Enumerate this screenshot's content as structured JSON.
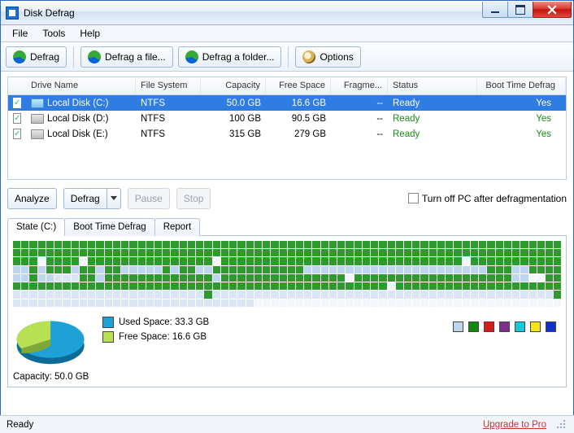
{
  "window": {
    "title": "Disk Defrag"
  },
  "menu": {
    "file": "File",
    "tools": "Tools",
    "help": "Help"
  },
  "toolbar": {
    "defrag": "Defrag",
    "defrag_file": "Defrag a file...",
    "defrag_folder": "Defrag a folder...",
    "options": "Options"
  },
  "columns": {
    "drive": "Drive Name",
    "fs": "File System",
    "capacity": "Capacity",
    "free": "Free Space",
    "frag": "Fragme...",
    "status": "Status",
    "boot": "Boot Time Defrag"
  },
  "drives": [
    {
      "name": "Local Disk (C:)",
      "fs": "NTFS",
      "capacity": "50.0 GB",
      "free": "16.6 GB",
      "frag": "--",
      "status": "Ready",
      "boot": "Yes",
      "selected": true
    },
    {
      "name": "Local Disk (D:)",
      "fs": "NTFS",
      "capacity": "100 GB",
      "free": "90.5 GB",
      "frag": "--",
      "status": "Ready",
      "boot": "Yes",
      "selected": false
    },
    {
      "name": "Local Disk (E:)",
      "fs": "NTFS",
      "capacity": "315 GB",
      "free": "279 GB",
      "frag": "--",
      "status": "Ready",
      "boot": "Yes",
      "selected": false
    }
  ],
  "actions": {
    "analyze": "Analyze",
    "defrag": "Defrag",
    "pause": "Pause",
    "stop": "Stop",
    "turnoff": "Turn off PC after defragmentation"
  },
  "tabs": {
    "state": "State (C:)",
    "boot": "Boot Time Defrag",
    "report": "Report"
  },
  "legend": {
    "used": "Used Space: 33.3 GB",
    "free": "Free Space: 16.6 GB",
    "capacity": "Capacity: 50.0 GB"
  },
  "legend_colors": [
    "#bdd5ef",
    "#108a10",
    "#d31c1c",
    "#7e2f8e",
    "#18c8d8",
    "#f4e515",
    "#1030c8"
  ],
  "pie": {
    "used_color": "#1ea1d6",
    "free_color": "#b7e052",
    "used_frac": 0.666
  },
  "status": {
    "ready": "Ready",
    "upgrade": "Upgrade to Pro"
  },
  "cluster_rows": [
    "gggggggggggggggggggggggggggggggggggggggggggggggggggggggggggggggggg",
    "gggggggggggggggggggggggggggggggggggggggggggggggggggggggggggggggggg",
    "gggwggggwgggggggggggggggwgggggggggggggggggggggggggggggwggggggggggg",
    "llglggglgglgglllllglggllgggggggggggllllllllllllllllllllllgggllgggg",
    "llgllvvvgglggggggggggggglgggggggggggggggwgggggggggggggggggggllwwgg",
    "gggggggggggggggggggggggggggggggggggggggggggggwgggggggggggggggggggg",
    "vvvvvvvvvvvvvvvvvvvvvvvgvvvvvvvvvvvvvvvvvvvvvvvvvvvvvvvvvvvvvvvvvg",
    "vvvvvvvvvvvvvvvvvvvvvvvvvvvvvwwwwwwwwwwwwwwwwwwwwwwwwwwwwwwwwwwwww"
  ]
}
